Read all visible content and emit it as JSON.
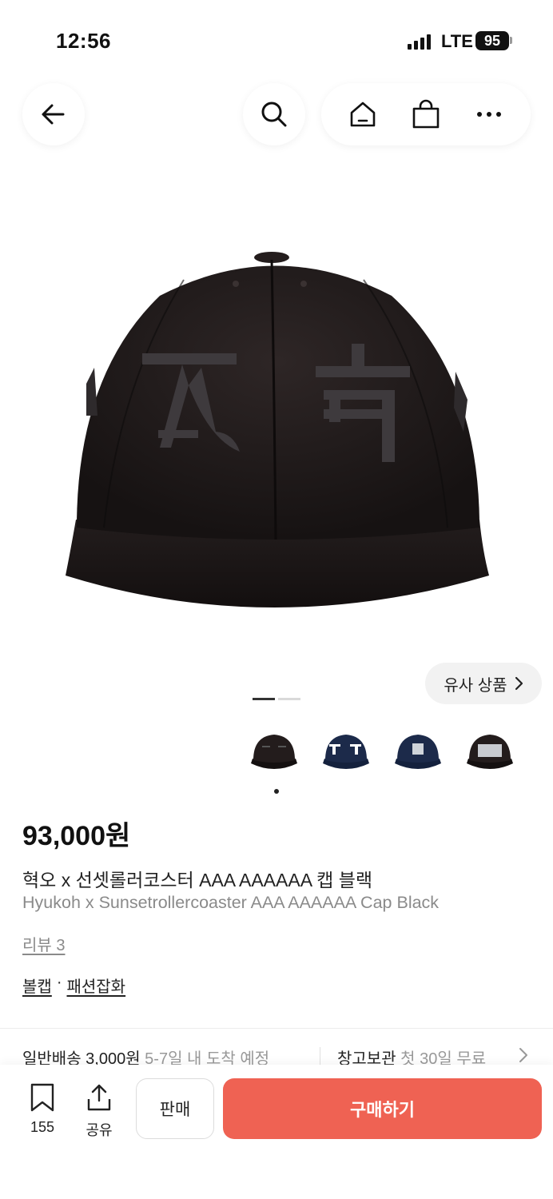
{
  "status_bar": {
    "time": "12:56",
    "network": "LTE",
    "battery": "95"
  },
  "header": {
    "icons": [
      "back-arrow-icon",
      "search-icon",
      "home-icon",
      "shopping-bag-icon",
      "more-icon"
    ]
  },
  "product": {
    "image_alt_icon": "cap-image",
    "similar_label": "유사 상품",
    "thumbnails_count": 4,
    "price": "93,000원",
    "title_ko": "혁오 x 선셋롤러코스터 AAA AAAAAA 캡 블랙",
    "title_en": "Hyukoh x Sunsetrollercoaster AAA AAAAAA Cap Black",
    "review_label": "리뷰 3",
    "category": {
      "primary": "볼캡",
      "separator": "·",
      "secondary": "패션잡화"
    }
  },
  "shipping": {
    "label": "일반배송 3,000원",
    "eta": "5-7일 내 도착 예정",
    "storage_label": "창고보관",
    "storage_note": "첫 30일 무료"
  },
  "bottom": {
    "bookmark_count": "155",
    "share_label": "공유",
    "sell_label": "판매",
    "buy_label": "구매하기"
  },
  "colors": {
    "accent": "#ef6253",
    "cap": "#1f1a1a",
    "navy_cap": "#1c2a4a"
  }
}
